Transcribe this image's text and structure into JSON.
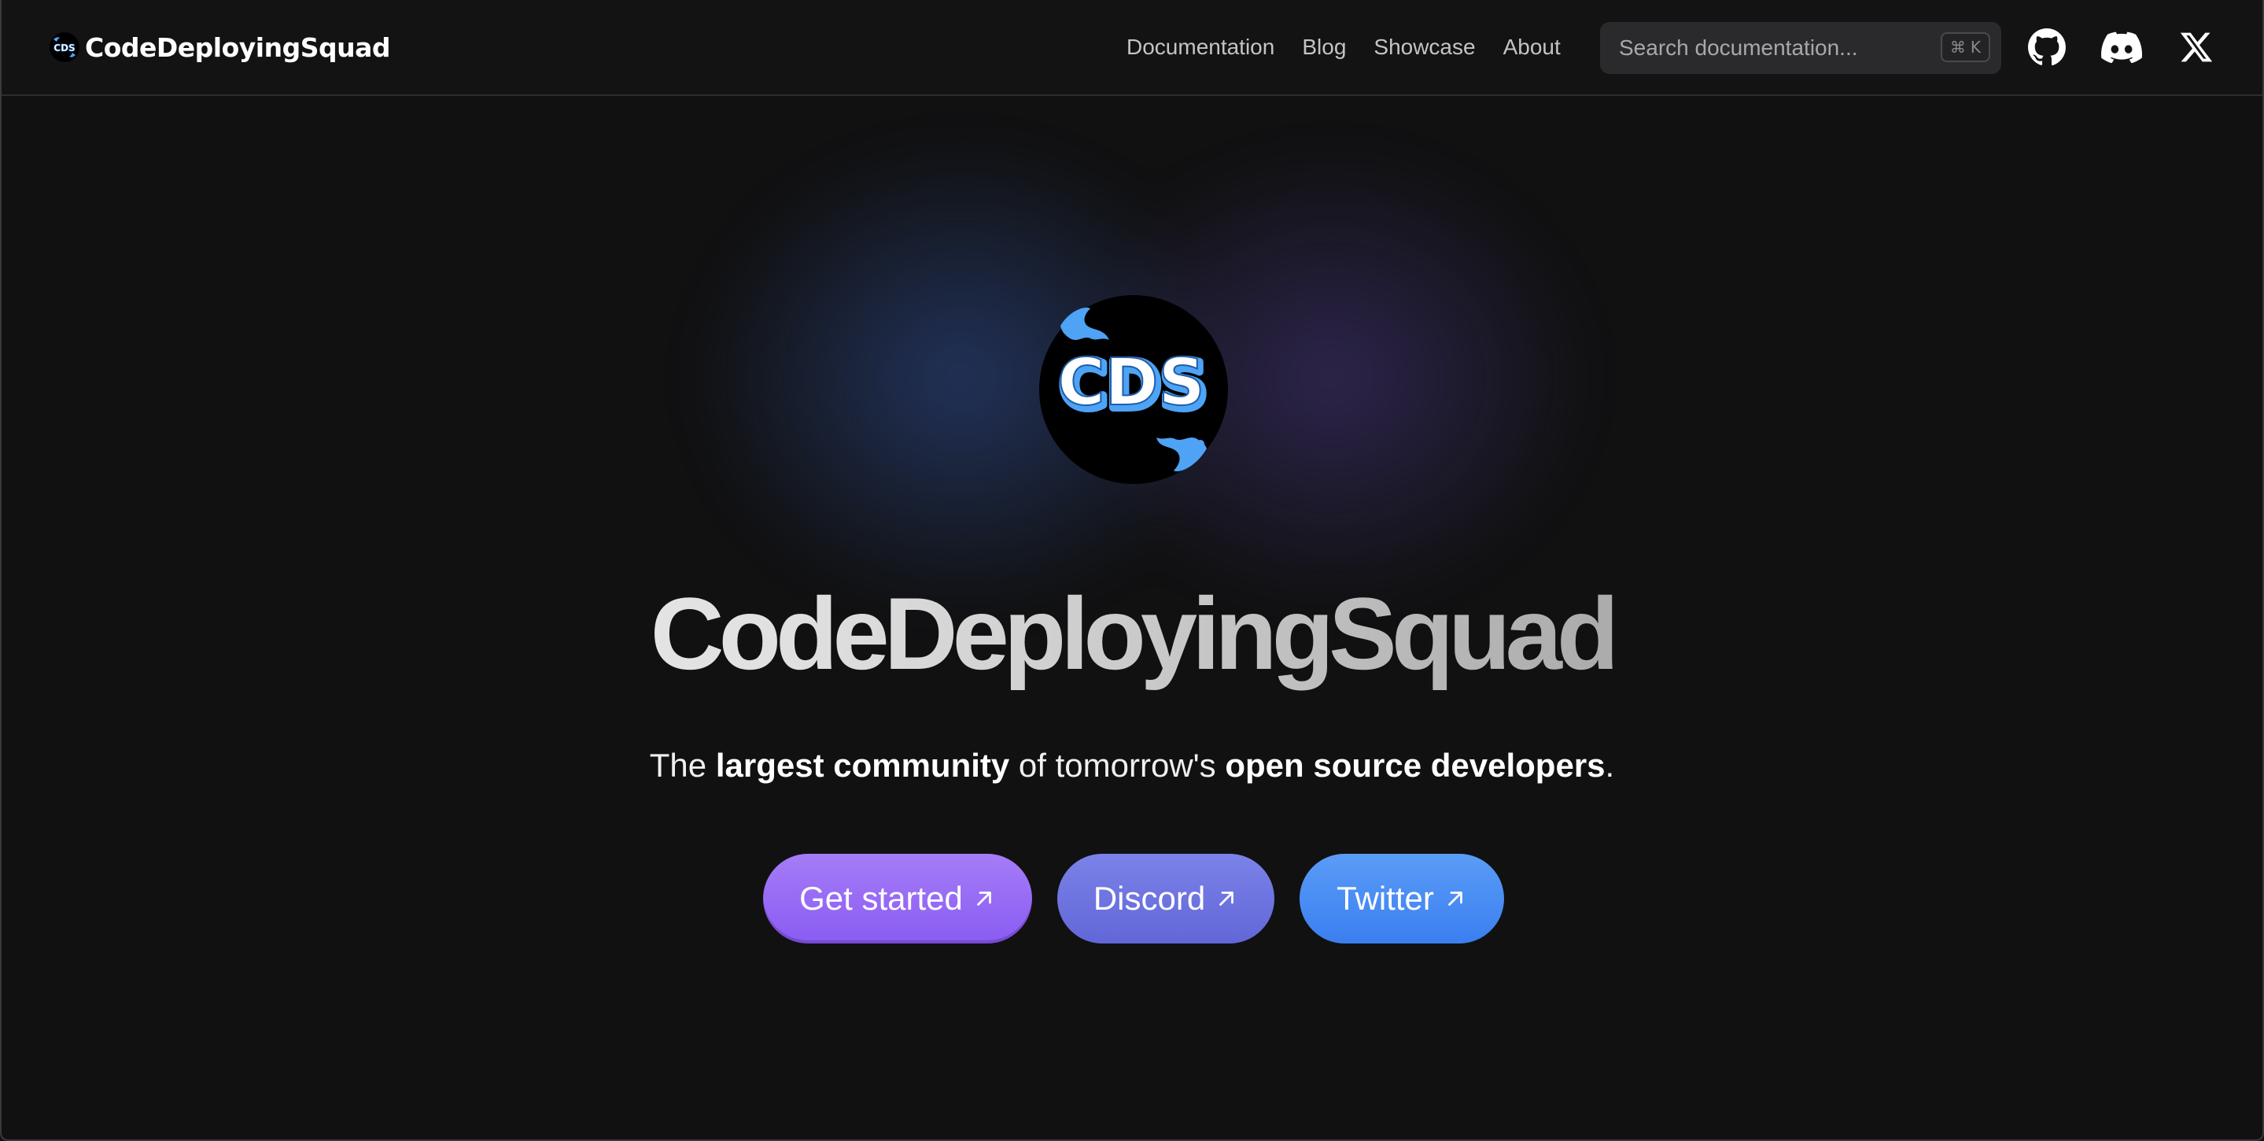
{
  "navbar": {
    "brand_name": "CodeDeployingSquad",
    "brand_logo_text": "CDS",
    "links": [
      {
        "label": "Documentation"
      },
      {
        "label": "Blog"
      },
      {
        "label": "Showcase"
      },
      {
        "label": "About"
      }
    ],
    "search": {
      "placeholder": "Search documentation...",
      "shortcut_symbol": "⌘",
      "shortcut_key": "K"
    },
    "social_icons": [
      "github-icon",
      "discord-icon",
      "x-icon"
    ]
  },
  "hero": {
    "logo_text": "CDS",
    "title": "CodeDeployingSquad",
    "tagline": {
      "part1": "The ",
      "bold1": "largest community",
      "part2": " of tomorrow's ",
      "bold2": "open source developers",
      "part3": "."
    },
    "buttons": [
      {
        "label": "Get started",
        "icon": "arrow-up-right-icon"
      },
      {
        "label": "Discord",
        "icon": "arrow-up-right-icon"
      },
      {
        "label": "Twitter",
        "icon": "arrow-up-right-icon"
      }
    ]
  },
  "colors": {
    "background": "#111112",
    "accent_purple": "#8a5cf2",
    "accent_indigo": "#6167d8",
    "accent_blue": "#3b7ff0",
    "logo_blue": "#4ea3f5"
  }
}
